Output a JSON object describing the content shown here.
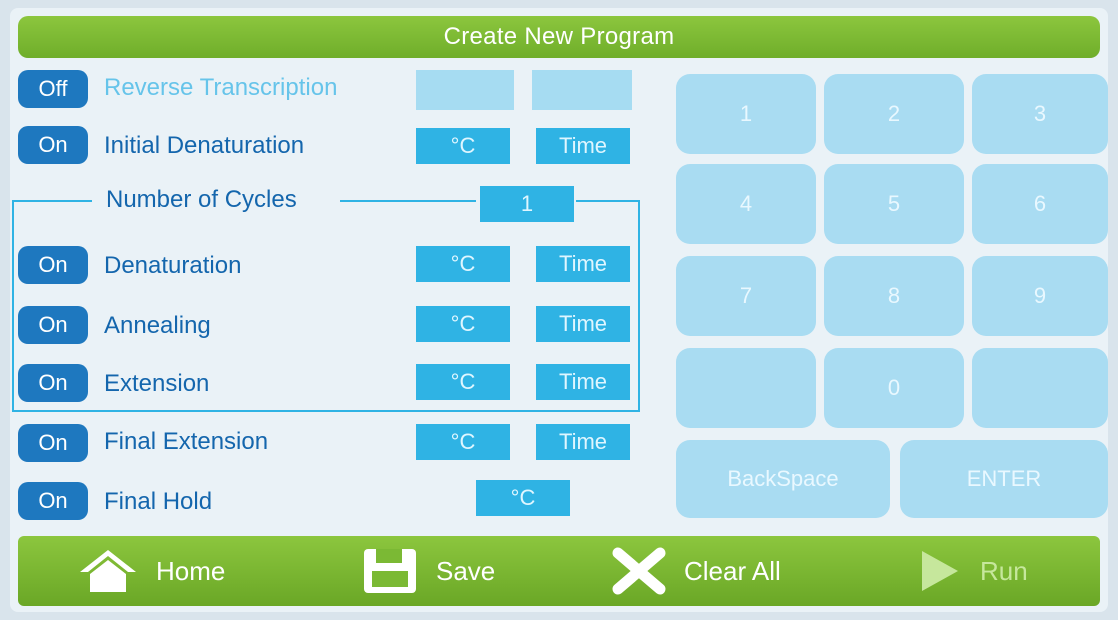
{
  "title": "Create New Program",
  "steps": {
    "reverse_transcription": {
      "toggle": "Off",
      "label": "Reverse Transcription",
      "temp": "",
      "time": ""
    },
    "initial_denaturation": {
      "toggle": "On",
      "label": "Initial Denaturation",
      "temp": "°C",
      "time": "Time"
    },
    "denaturation": {
      "toggle": "On",
      "label": "Denaturation",
      "temp": "°C",
      "time": "Time"
    },
    "annealing": {
      "toggle": "On",
      "label": "Annealing",
      "temp": "°C",
      "time": "Time"
    },
    "extension": {
      "toggle": "On",
      "label": "Extension",
      "temp": "°C",
      "time": "Time"
    },
    "final_extension": {
      "toggle": "On",
      "label": "Final Extension",
      "temp": "°C",
      "time": "Time"
    },
    "final_hold": {
      "toggle": "On",
      "label": "Final Hold",
      "temp": "°C"
    }
  },
  "cycles": {
    "label": "Number of Cycles",
    "value": "1"
  },
  "numpad": {
    "k1": "1",
    "k2": "2",
    "k3": "3",
    "k4": "4",
    "k5": "5",
    "k6": "6",
    "k7": "7",
    "k8": "8",
    "k9": "9",
    "k0": "0",
    "backspace": "BackSpace",
    "enter": "ENTER"
  },
  "toolbar": {
    "home": "Home",
    "save": "Save",
    "clear": "Clear All",
    "run": "Run"
  },
  "icons": {
    "home": "home-icon",
    "save": "save-icon",
    "clear": "close-icon",
    "run": "play-icon"
  },
  "colors": {
    "green": "#7bb934",
    "blue_toggle": "#1e78bf",
    "field": "#2fb3e4",
    "label": "#1466ad"
  }
}
